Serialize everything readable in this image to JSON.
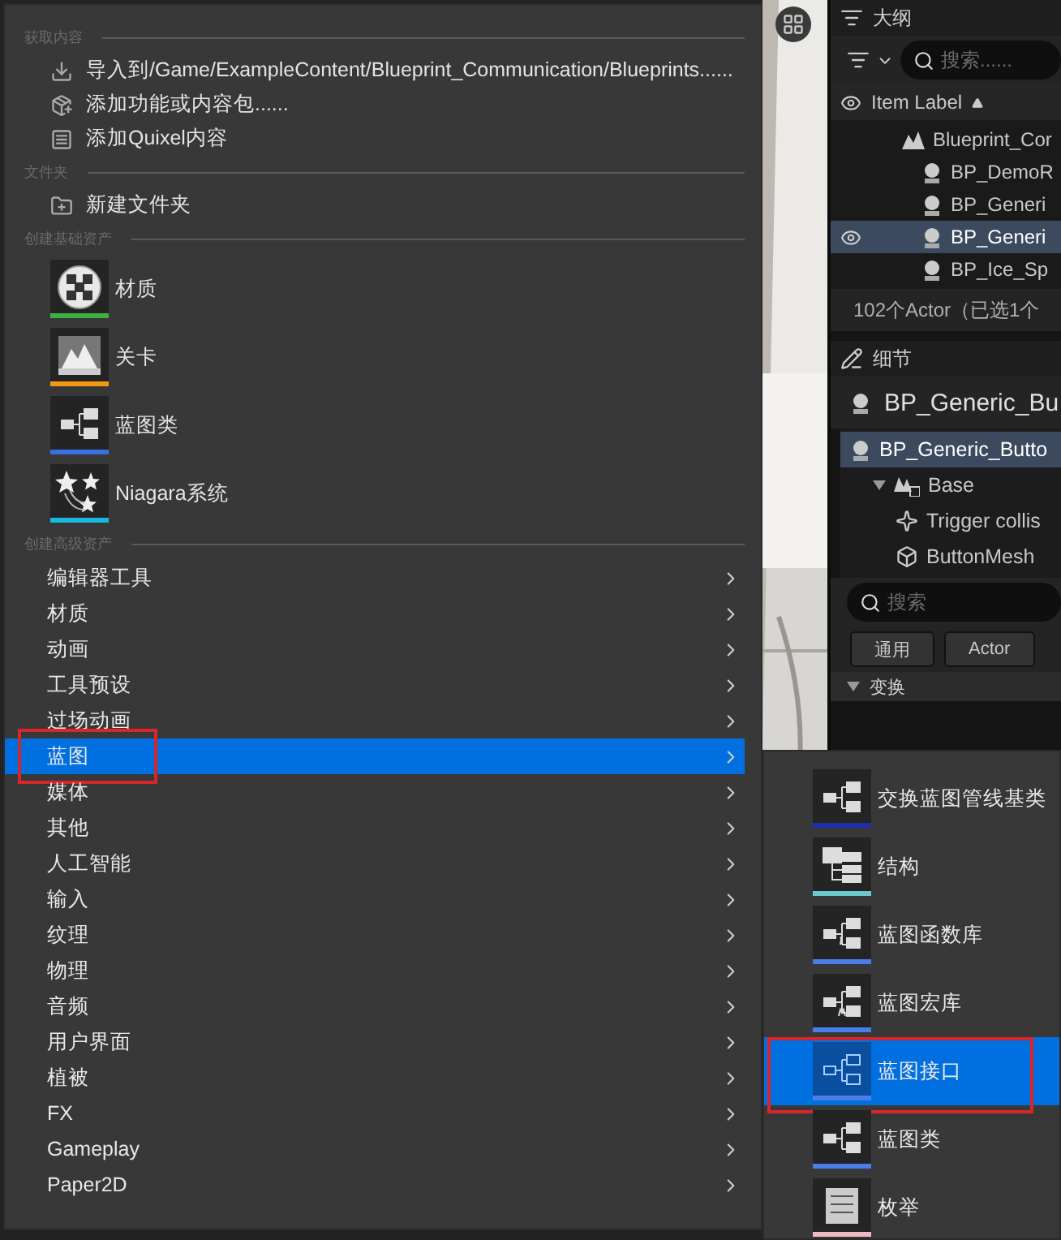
{
  "menu": {
    "sections": [
      {
        "title": "获取内容",
        "kind": "actions",
        "items": [
          {
            "label": "导入到/Game/ExampleContent/Blueprint_Communication/Blueprints......",
            "kind": "import"
          },
          {
            "label": "添加功能或内容包......",
            "kind": "pack"
          },
          {
            "label": "添加Quixel内容",
            "kind": "quixel"
          }
        ]
      },
      {
        "title": "文件夹",
        "kind": "actions",
        "items": [
          {
            "label": "新建文件夹",
            "kind": "folder"
          }
        ]
      },
      {
        "title": "创建基础资产",
        "kind": "tiles",
        "items": [
          {
            "label": "材质",
            "kind": "material",
            "color": "#3cb043"
          },
          {
            "label": "关卡",
            "kind": "level",
            "color": "#f59a10"
          },
          {
            "label": "蓝图类",
            "kind": "blueprint",
            "color": "#3a6fe0"
          },
          {
            "label": "Niagara系统",
            "kind": "niagara",
            "color": "#19b8e0"
          }
        ]
      },
      {
        "title": "创建高级资产",
        "kind": "submenus",
        "items": [
          {
            "label": "编辑器工具",
            "selected": false,
            "annotated": false
          },
          {
            "label": "材质",
            "selected": false,
            "annotated": false
          },
          {
            "label": "动画",
            "selected": false,
            "annotated": false
          },
          {
            "label": "工具预设",
            "selected": false,
            "annotated": false
          },
          {
            "label": "过场动画",
            "selected": false,
            "annotated": false
          },
          {
            "label": "蓝图",
            "selected": true,
            "annotated": true
          },
          {
            "label": "媒体",
            "selected": false,
            "annotated": false
          },
          {
            "label": "其他",
            "selected": false,
            "annotated": false
          },
          {
            "label": "人工智能",
            "selected": false,
            "annotated": false
          },
          {
            "label": "输入",
            "selected": false,
            "annotated": false
          },
          {
            "label": "纹理",
            "selected": false,
            "annotated": false
          },
          {
            "label": "物理",
            "selected": false,
            "annotated": false
          },
          {
            "label": "音频",
            "selected": false,
            "annotated": false
          },
          {
            "label": "用户界面",
            "selected": false,
            "annotated": false
          },
          {
            "label": "植被",
            "selected": false,
            "annotated": false
          },
          {
            "label": "FX",
            "selected": false,
            "annotated": false
          },
          {
            "label": "Gameplay",
            "selected": false,
            "annotated": false
          },
          {
            "label": "Paper2D",
            "selected": false,
            "annotated": false
          }
        ]
      }
    ]
  },
  "submenu": {
    "items": [
      {
        "label": "交换蓝图管线基类",
        "kind": "blueprint",
        "color": "#1c2fa8",
        "selected": false,
        "annotated": false
      },
      {
        "label": "结构",
        "kind": "struct",
        "color": "#6cc8cf",
        "selected": false,
        "annotated": false
      },
      {
        "label": "蓝图函数库",
        "kind": "function-library",
        "color": "#4a7de8",
        "selected": false,
        "annotated": false
      },
      {
        "label": "蓝图宏库",
        "kind": "macro-library",
        "color": "#4a7de8",
        "selected": false,
        "annotated": false
      },
      {
        "label": "蓝图接口",
        "kind": "interface",
        "color": "#4a7de8",
        "selected": true,
        "annotated": true
      },
      {
        "label": "蓝图类",
        "kind": "blueprint",
        "color": "#4a7de8",
        "selected": false,
        "annotated": false
      },
      {
        "label": "枚举",
        "kind": "enum",
        "color": "#f0b8c4",
        "selected": false,
        "annotated": false
      }
    ]
  },
  "outliner": {
    "title": "大纲",
    "search": {
      "placeholder": "搜索......"
    },
    "column": "Item Label",
    "tree": [
      {
        "label": "Blueprint_Cor",
        "kind": "level",
        "selected": false,
        "children": [
          {
            "label": "BP_DemoR",
            "kind": "actor",
            "selected": false
          },
          {
            "label": "BP_Generi",
            "kind": "actor",
            "selected": false
          },
          {
            "label": "BP_Generi",
            "kind": "actor",
            "selected": true
          },
          {
            "label": "BP_Ice_Sp",
            "kind": "actor",
            "selected": false
          }
        ]
      }
    ],
    "status": "102个Actor（已选1个"
  },
  "details": {
    "title": "细节",
    "object": "BP_Generic_Bu",
    "tree": [
      {
        "label": "BP_Generic_Butto",
        "kind": "actor",
        "selected": true,
        "children": [
          {
            "label": "Base",
            "kind": "mesh-root",
            "selected": false,
            "expanded": true,
            "children": [
              {
                "label": "Trigger collis",
                "kind": "trigger",
                "selected": false
              },
              {
                "label": "ButtonMesh",
                "kind": "mesh",
                "selected": false
              }
            ]
          }
        ]
      }
    ],
    "search": {
      "placeholder": "搜索"
    },
    "filters": [
      "通用",
      "Actor"
    ],
    "section": {
      "label": "变换",
      "expanded": true
    }
  }
}
